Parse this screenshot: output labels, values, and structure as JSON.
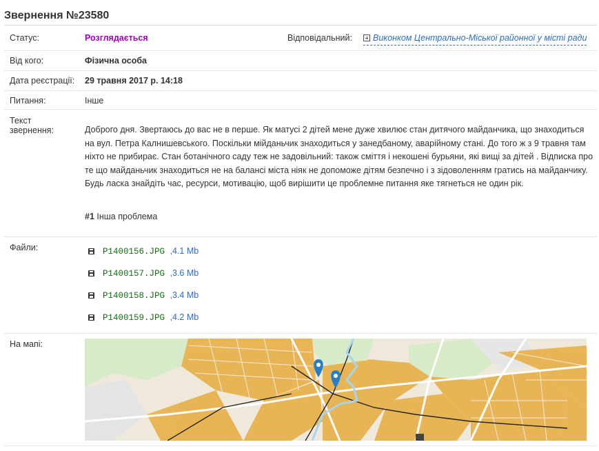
{
  "title": "Звернення №23580",
  "status": {
    "label": "Статус:",
    "value": "Розглядається",
    "color": "#a000b8"
  },
  "responsible": {
    "label": "Відповідальний:",
    "value": "Виконком Центрально-Міської районної у місті ради",
    "icon": "expand-icon"
  },
  "from": {
    "label": "Від кого:",
    "value": "Фізична особа"
  },
  "reg_date": {
    "label": "Дата реєстрації:",
    "value": "29 травня 2017 р. 14:18"
  },
  "topic": {
    "label": "Питання:",
    "value": "Інше"
  },
  "text": {
    "label_line1": "Текст",
    "label_line2": "звернення:",
    "body": "Доброго дня. Звертаюсь до вас не в перше. Як матусі 2 дітей мене дуже хвилює стан дитячого майданчика, що знаходиться на вул. Петра Калнишевського. Поскільки мійданьчик знаходиться у занедбаному, аварійному стані. До того ж з 9 травня там ніхто не прибирає. Стан ботанічного саду теж не задовільний: також сміття і некошені бурьяни, які вищі за дітей . Відписка про те що майданьчик знаходиться не на балансі міста ніяк не допоможе дітям безпечно і з зідоволенням гратись на майданчику. Будь ласка знайдіть час, ресурси, мотивацію, щоб вирішити це проблемне питання яке тягнеться не один рік.",
    "problem_number": "#1",
    "problem_label": "Інша проблема"
  },
  "files": {
    "label": "Файли:",
    "items": [
      {
        "name": "P1400156.JPG",
        "size": ",4.1 Mb"
      },
      {
        "name": "P1400157.JPG",
        "size": ",3.6 Mb"
      },
      {
        "name": "P1400158.JPG",
        "size": ",3.4 Mb"
      },
      {
        "name": "P1400159.JPG",
        "size": ",4.2 Mb"
      }
    ]
  },
  "map": {
    "label": "На мапі:",
    "marker_color": "#2a7fc4",
    "building_color": "#e8b048"
  }
}
